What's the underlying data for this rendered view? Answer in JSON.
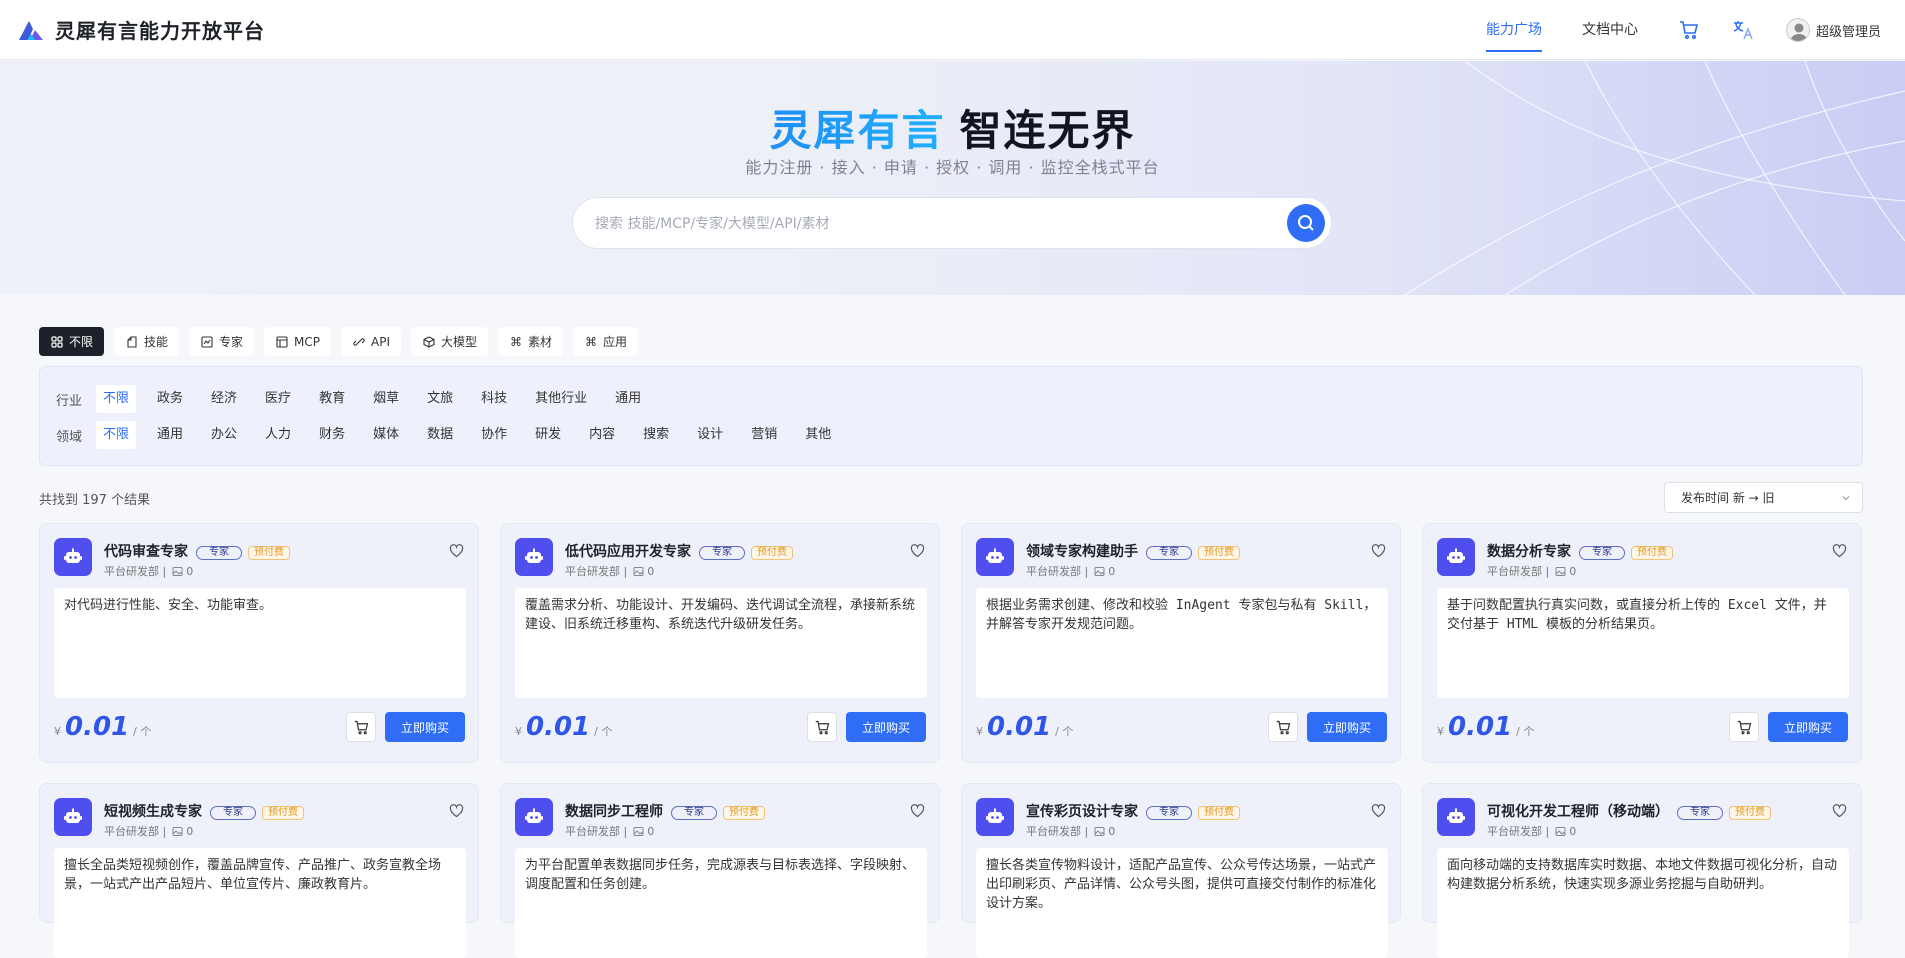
{
  "app": {
    "name": "灵犀有言能力开放平台"
  },
  "nav": {
    "links": [
      "能力广场",
      "文档中心"
    ],
    "user": "超级管理员"
  },
  "hero": {
    "title_highlight": "灵犀有言",
    "title_rest": "智连无界",
    "subtitle": "能力注册 · 接入 · 申请 · 授权 · 调用 · 监控全栈式平台",
    "search_placeholder": "搜索 技能/MCP/专家/大模型/API/素材"
  },
  "types": [
    {
      "label": "不限",
      "icon": "grid-icon",
      "active": true
    },
    {
      "label": "技能",
      "icon": "skill-icon"
    },
    {
      "label": "专家",
      "icon": "expert-icon"
    },
    {
      "label": "MCP",
      "icon": "mcp-icon"
    },
    {
      "label": "API",
      "icon": "api-icon"
    },
    {
      "label": "大模型",
      "icon": "cube-icon"
    },
    {
      "label": "素材",
      "icon": "command-icon"
    },
    {
      "label": "应用",
      "icon": "command-icon"
    }
  ],
  "filters": {
    "industry": {
      "label": "行业",
      "options": [
        "不限",
        "政务",
        "经济",
        "医疗",
        "教育",
        "烟草",
        "文旅",
        "科技",
        "其他行业",
        "通用"
      ],
      "selected": "不限"
    },
    "domain": {
      "label": "领域",
      "options": [
        "不限",
        "通用",
        "办公",
        "人力",
        "财务",
        "媒体",
        "数据",
        "协作",
        "研发",
        "内容",
        "搜索",
        "设计",
        "营销",
        "其他"
      ],
      "selected": "不限"
    }
  },
  "result_text": "共找到 197 个结果",
  "sort_label": "发布时间 新 → 旧",
  "card_common": {
    "tag_expert": "专家",
    "tag_prepay": "预付费",
    "org": "平台研发部 |",
    "count": "0",
    "currency": "¥",
    "unit": "/ 个",
    "buy_label": "立即购买"
  },
  "cards": [
    {
      "title": "代码审查专家",
      "desc": "对代码进行性能、安全、功能审查。",
      "price": "0.01"
    },
    {
      "title": "低代码应用开发专家",
      "desc": "覆盖需求分析、功能设计、开发编码、迭代调试全流程，承接新系统建设、旧系统迁移重构、系统迭代升级研发任务。",
      "price": "0.01"
    },
    {
      "title": "领域专家构建助手",
      "desc": "根据业务需求创建、修改和校验 InAgent 专家包与私有 Skill，并解答专家开发规范问题。",
      "price": "0.01"
    },
    {
      "title": "数据分析专家",
      "desc": "基于问数配置执行真实问数，或直接分析上传的 Excel 文件，并交付基于 HTML 模板的分析结果页。",
      "price": "0.01"
    },
    {
      "title": "短视频生成专家",
      "desc": "擅长全品类短视频创作，覆盖品牌宣传、产品推广、政务宣教全场景，一站式产出产品短片、单位宣传片、廉政教育片。",
      "price": ""
    },
    {
      "title": "数据同步工程师",
      "desc": "为平台配置单表数据同步任务，完成源表与目标表选择、字段映射、调度配置和任务创建。",
      "price": ""
    },
    {
      "title": "宣传彩页设计专家",
      "desc": "擅长各类宣传物料设计，适配产品宣传、公众号传达场景，一站式产出印刷彩页、产品详情、公众号头图，提供可直接交付制作的标准化设计方案。",
      "price": ""
    },
    {
      "title": "可视化开发工程师（移动端）",
      "desc": "面向移动端的支持数据库实时数据、本地文件数据可视化分析，自动构建数据分析系统，快速实现多源业务挖掘与自助研判。",
      "price": ""
    }
  ],
  "colors": {
    "accent": "#2f6df6",
    "bot": "#4f4ff0",
    "prepay": "#e09a20"
  }
}
